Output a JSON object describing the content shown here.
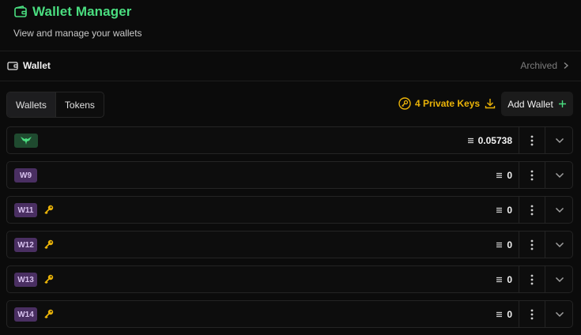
{
  "header": {
    "title": "Wallet Manager",
    "subtitle": "View and manage your wallets"
  },
  "section": {
    "label": "Wallet",
    "archived_label": "Archived"
  },
  "tabs": [
    {
      "label": "Wallets",
      "active": true
    },
    {
      "label": "Tokens",
      "active": false
    }
  ],
  "private_keys": {
    "label": "4 Private Keys"
  },
  "add_wallet": {
    "label": "Add Wallet"
  },
  "wallets": [
    {
      "badge": "",
      "badge_icon": "horned-logo-icon",
      "badge_color": "#1f4a2f",
      "has_key": false,
      "balance": "0.05738"
    },
    {
      "badge": "W9",
      "badge_color": "#4a2f62",
      "has_key": false,
      "balance": "0"
    },
    {
      "badge": "W11",
      "badge_color": "#4a2f62",
      "has_key": true,
      "balance": "0"
    },
    {
      "badge": "W12",
      "badge_color": "#4a2f62",
      "has_key": true,
      "balance": "0"
    },
    {
      "badge": "W13",
      "badge_color": "#4a2f62",
      "has_key": true,
      "balance": "0"
    },
    {
      "badge": "W14",
      "badge_color": "#4a2f62",
      "has_key": true,
      "balance": "0"
    }
  ],
  "colors": {
    "accent_green": "#4ade80",
    "key_yellow": "#eab308",
    "badge_purple": "#4a2f62"
  }
}
